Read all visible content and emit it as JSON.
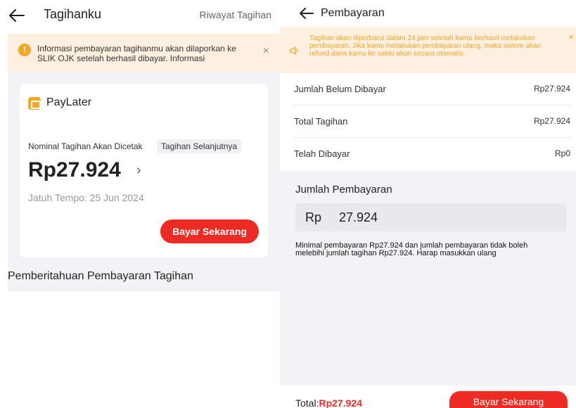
{
  "left": {
    "header": {
      "title": "Tagihanku",
      "history_label": "Riwayat Tagihan"
    },
    "banner": {
      "text": "Informasi pembayaran tagihanmu akan dilaporkan ke SLIK OJK setelah berhasil dibayar. Informasi",
      "close": "×"
    },
    "card": {
      "product": "PayLater",
      "nominal_label": "Nominal Tagihan Akan Dicetak",
      "nominal_chip": "Tagihan Selanjutnya",
      "amount": "Rp27.924",
      "chevron": "›",
      "due_date": "Jatuh Tempo: 25 Jun 2024",
      "pay_label": "Bayar Sekarang"
    },
    "section_title": "Pemberitahuan Pembayaran Tagihan"
  },
  "right": {
    "header": {
      "title": "Pembayaran"
    },
    "banner": {
      "text": "Tagihan akan diperbarui dalam 24 jam setelah kamu berhasil melakukan pembayaran. Jika kamu melakukan pembayaran ulang, maka sistem akan refund dana kamu ke saldo akun secara otomatis.",
      "close": "×"
    },
    "rows": [
      {
        "label": "Jumlah Belum Dibayar",
        "value": "Rp27.924"
      },
      {
        "label": "Total Tagihan",
        "value": "Rp27.924"
      },
      {
        "label": "Telah Dibayar",
        "value": "Rp0"
      }
    ],
    "payment": {
      "label": "Jumlah Pembayaran",
      "currency": "Rp",
      "amount": "27.924",
      "note": "Minimal pembayaran Rp27.924 dan jumlah pembayaran tidak boleh melebihi jumlah tagihan Rp27.924. Harap masukkan ulang"
    },
    "footer": {
      "total_label": "Total:",
      "total_value": "Rp27.924",
      "pay_label": "Bayar Sekarang"
    }
  },
  "colors": {
    "accent_red": "#ee2a24",
    "warning_orange": "#f5a623",
    "banner_bg": "#fdf0e1",
    "page_bg": "#f1f3f6"
  }
}
